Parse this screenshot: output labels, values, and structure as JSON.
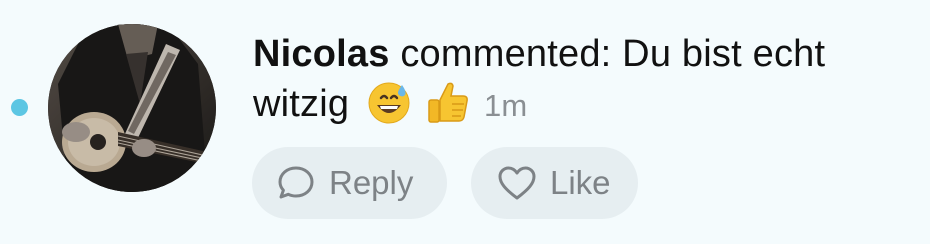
{
  "notification": {
    "actor": "Nicolas",
    "message": " commented: Du bist echt witzig",
    "emojis": [
      "grinning-face-with-sweat",
      "thumbs-up"
    ],
    "timestamp": "1m",
    "unread": true
  },
  "actions": {
    "reply_label": "Reply",
    "like_label": "Like"
  },
  "colors": {
    "background": "#f4fbfd",
    "unread_dot": "#5cc6e3",
    "button_bg": "#e6eef1",
    "muted_text": "#8a8f93"
  }
}
